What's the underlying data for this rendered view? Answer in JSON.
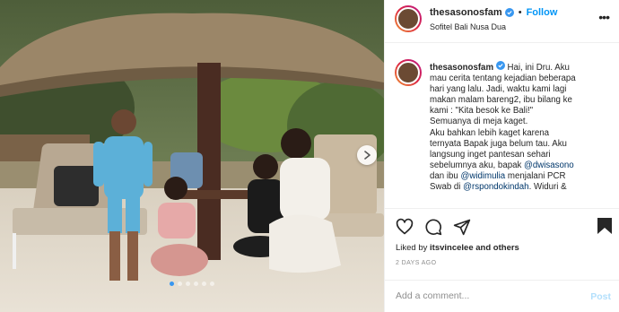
{
  "post": {
    "username": "thesasonosfam",
    "follow_label": "Follow",
    "separator": "•",
    "location": "Sofitel Bali Nusa Dua",
    "more_label": "•••",
    "caption_user": "thesasonosfam",
    "caption_lines": [
      "Hai, ini Dru. Aku",
      "mau cerita tentang kejadian beberapa",
      "hari yang lalu. Jadi, waktu kami lagi",
      "makan malam bareng2, ibu bilang ke",
      "kami : \"Kita besok ke Bali!\"",
      "Semuanya di meja kaget.",
      "Aku bahkan lebih kaget karena",
      "ternyata Bapak juga belum tau. Aku",
      "langsung inget pantesan sehari",
      "sebelumnya aku, bapak",
      "dan ibu",
      "Swab di",
      "Widuri &"
    ],
    "mentions": [
      "@dwisasono",
      "@widimulia",
      "@rspondokindah"
    ],
    "caption_suffix_pcr": "menjalani PCR",
    "caption_suffix_comma": ". ",
    "liked_prefix": "Liked by",
    "liked_user": "itsvincelee",
    "liked_suffix": "and others",
    "time_ago": "2 DAYS AGO",
    "comment_placeholder": "Add a comment...",
    "post_label": "Post",
    "carousel": {
      "count": 6,
      "active": 0
    },
    "colors": {
      "follow": "#0095f6",
      "mention": "#00376b",
      "carousel_active": "#3897f0"
    },
    "icons": [
      "verified-badge-icon",
      "heart-icon",
      "comment-icon",
      "share-icon",
      "bookmark-icon",
      "chevron-right-icon"
    ]
  }
}
